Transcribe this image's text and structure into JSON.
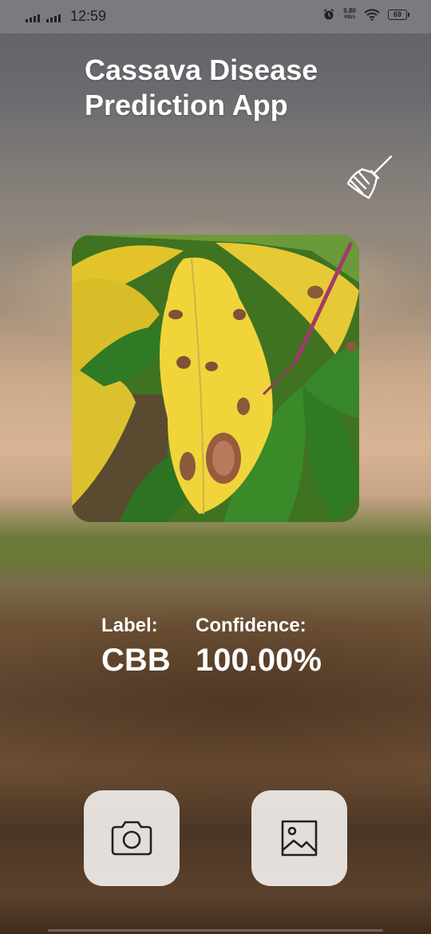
{
  "status_bar": {
    "time": "12:59",
    "network_speed_value": "0.80",
    "network_speed_unit": "KB/s",
    "battery_level": "69",
    "icons": [
      "signal-icon",
      "signal-icon",
      "alarm-icon",
      "wifi-icon",
      "battery-icon"
    ]
  },
  "app": {
    "title_line1": "Cassava Disease",
    "title_line2": "Prediction App",
    "clear_icon": "broom-icon"
  },
  "prediction": {
    "label_caption": "Label:",
    "label_value": "CBB",
    "confidence_caption": "Confidence:",
    "confidence_value": "100.00%"
  },
  "actions": {
    "camera_icon": "camera-icon",
    "gallery_icon": "image-icon"
  },
  "colors": {
    "text": "#ffffff",
    "button_bg": "#f0ede9",
    "icon_stroke": "#222222"
  }
}
